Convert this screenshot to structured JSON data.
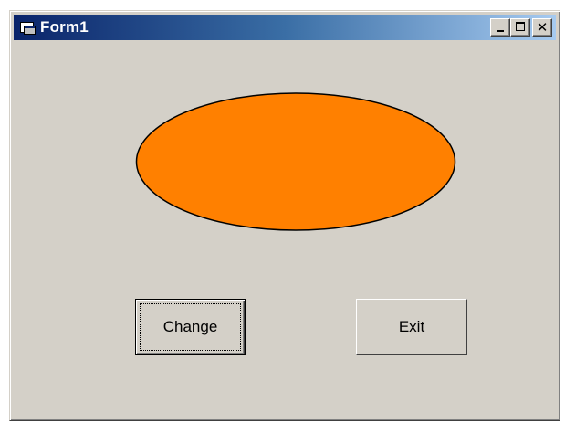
{
  "window": {
    "title": "Form1",
    "icon": "form-icon",
    "caption_buttons": [
      "minimize",
      "maximize",
      "close"
    ],
    "close_glyph": "✕"
  },
  "canvas": {
    "shape": {
      "type": "ellipse",
      "fill_color": "#ff8000",
      "stroke_color": "#000000"
    }
  },
  "buttons": {
    "change_label": "Change",
    "exit_label": "Exit"
  },
  "colors": {
    "form_background": "#d4d0c8",
    "titlebar_start": "#0a246a",
    "titlebar_end": "#a6caf0"
  }
}
